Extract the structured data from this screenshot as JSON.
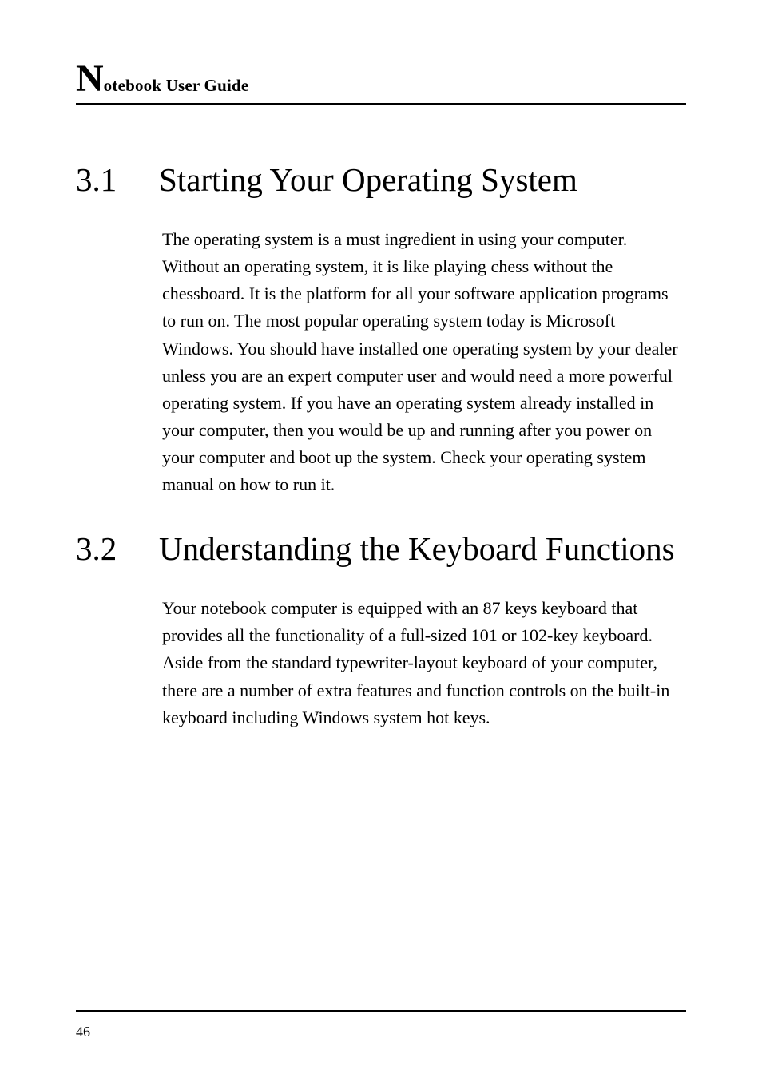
{
  "header": {
    "dropcap": "N",
    "rest": "otebook User Guide"
  },
  "sections": [
    {
      "number": "3.1",
      "title": "Starting Your Operating System",
      "body": "The operating system is a must ingredient in using your computer. Without an operating system, it is like playing chess without the chessboard. It is the platform for all your software application programs to run on. The most popular operating system today is Microsoft Windows. You should have installed one operating system by your dealer unless you are an expert computer user and would need a more powerful operating system. If you have an operating system already installed in your computer, then you would be up and running after you power on your computer and boot up the system. Check your operating system manual on how to run it."
    },
    {
      "number": "3.2",
      "title": "Understanding the Keyboard Functions",
      "body": "Your notebook computer is equipped with an 87 keys keyboard that provides all the functionality of a full-sized 101 or 102-key keyboard. Aside from the standard typewriter-layout keyboard of your computer, there are a number of extra features and function controls on the built-in keyboard including Windows system hot keys."
    }
  ],
  "page_number": "46"
}
